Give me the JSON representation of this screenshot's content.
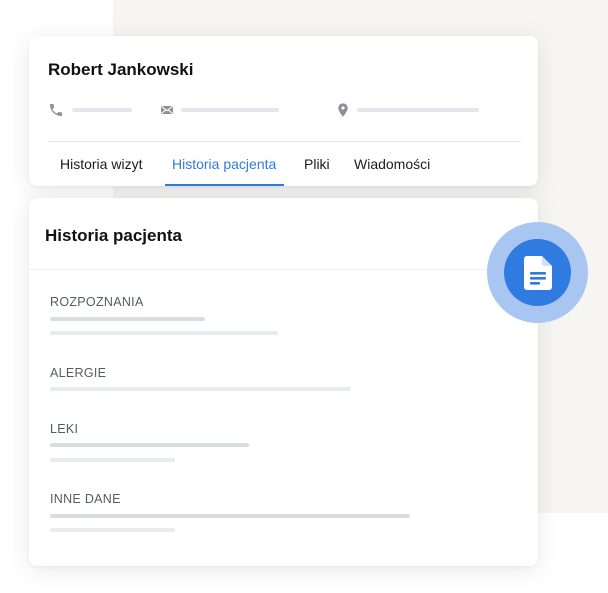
{
  "patient": {
    "name": "Robert Jankowski",
    "contacts": [
      {
        "icon": "phone-icon"
      },
      {
        "icon": "mail-icon"
      },
      {
        "icon": "location-pin-icon"
      }
    ]
  },
  "tabs": [
    {
      "label": "Historia wizyt",
      "active": false
    },
    {
      "label": "Historia pacjenta",
      "active": true
    },
    {
      "label": "Pliki",
      "active": false
    },
    {
      "label": "Wiadomości",
      "active": false
    }
  ],
  "history": {
    "title": "Historia pacjenta",
    "sections": [
      {
        "label": "ROZPOZNANIA"
      },
      {
        "label": "ALERGIE"
      },
      {
        "label": "LEKI"
      },
      {
        "label": "INNE DANE"
      }
    ]
  },
  "fab": {
    "icon": "document-icon"
  },
  "colors": {
    "accent": "#2f7be0",
    "accent_halo": "#a9c5f1",
    "background_panel": "#f6f5f1",
    "text_primary": "#111111",
    "placeholder_line": "#e3e6ea"
  }
}
